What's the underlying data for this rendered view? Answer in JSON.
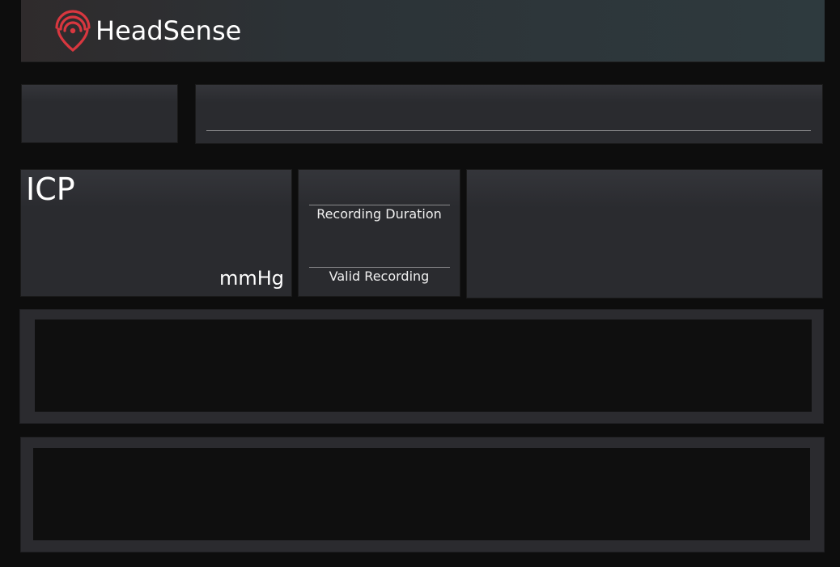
{
  "app": {
    "brand_name": "HeadSense",
    "brand_color": "#d8373f"
  },
  "icp_panel": {
    "title": "ICP",
    "unit": "mmHg"
  },
  "recording_panel": {
    "duration_label": "Recording Duration",
    "valid_label": "Valid Recording"
  },
  "icons": {
    "logo": "signal-location-pin-icon"
  },
  "colors": {
    "background": "#0d0d0d",
    "panel": "#2a2b2f",
    "plot_area": "#0f0f0f",
    "text": "#ffffff"
  }
}
